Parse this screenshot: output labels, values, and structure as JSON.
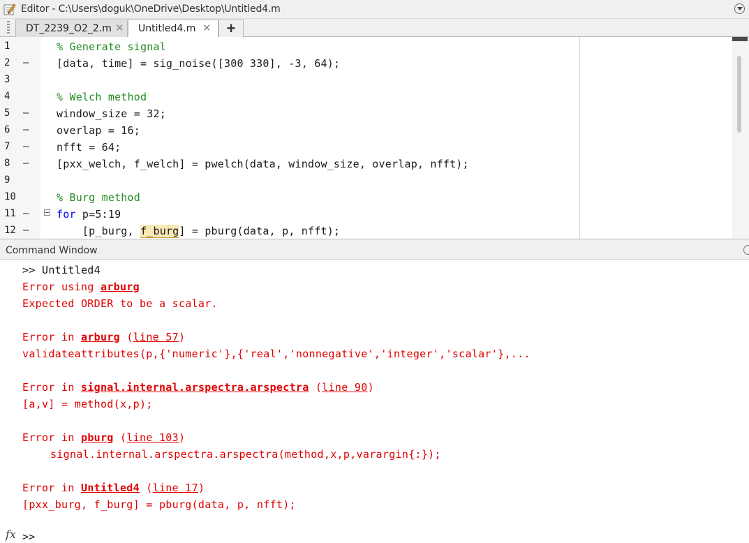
{
  "editor": {
    "title": "Editor - C:\\Users\\doguk\\OneDrive\\Desktop\\Untitled4.m",
    "tabs": [
      {
        "label": "DT_2239_O2_2.m",
        "active": false
      },
      {
        "label": "Untitled4.m",
        "active": true
      }
    ],
    "close_glyph": "✕",
    "add_tab_glyph": "+",
    "lines": [
      {
        "n": "1",
        "dash": "",
        "code": "% Generate signal",
        "type": "comment"
      },
      {
        "n": "2",
        "dash": "–",
        "code": "[data, time] = sig_noise([300 330], -3, 64);",
        "type": "code"
      },
      {
        "n": "3",
        "dash": "",
        "code": "",
        "type": "code"
      },
      {
        "n": "4",
        "dash": "",
        "code": "% Welch method",
        "type": "comment"
      },
      {
        "n": "5",
        "dash": "–",
        "code": "window_size = 32;",
        "type": "code"
      },
      {
        "n": "6",
        "dash": "–",
        "code": "overlap = 16;",
        "type": "code"
      },
      {
        "n": "7",
        "dash": "–",
        "code": "nfft = 64;",
        "type": "code"
      },
      {
        "n": "8",
        "dash": "–",
        "code": "[pxx_welch, f_welch] = pwelch(data, window_size, overlap, nfft);",
        "type": "code"
      },
      {
        "n": "9",
        "dash": "",
        "code": "",
        "type": "code"
      },
      {
        "n": "10",
        "dash": "",
        "code": "% Burg method",
        "type": "comment"
      },
      {
        "n": "11",
        "dash": "–",
        "kw": "for",
        "code": " p=5:19",
        "type": "for"
      },
      {
        "n": "12",
        "dash": "–",
        "pre": "    [p_burg, ",
        "hl": "f_burg",
        "code": "] = pburg(data, p, nfft);",
        "type": "hl"
      }
    ]
  },
  "command_window": {
    "title": "Command Window",
    "fx_label": "fx",
    "bottom_prompt": ">>",
    "output": {
      "l1": ">> Untitled4",
      "l2_pre": "Error using ",
      "l2_fn": "arburg",
      "l3": "Expected ORDER to be a scalar.",
      "l4_pre": "Error in ",
      "l4_fn": "arburg",
      "l4_mid": " (",
      "l4_link": "line 57",
      "l4_post": ")",
      "l5": "validateattributes(p,{'numeric'},{'real','nonnegative','integer','scalar'},...",
      "l6_pre": "Error in ",
      "l6_fn": "signal.internal.arspectra.arspectra",
      "l6_mid": " (",
      "l6_link": "line 90",
      "l6_post": ")",
      "l7": "[a,v] = method(x,p);",
      "l8_pre": "Error in ",
      "l8_fn": "pburg",
      "l8_mid": " (",
      "l8_link": "line 103",
      "l8_post": ")",
      "l9": "signal.internal.arspectra.arspectra(method,x,p,varargin{:});",
      "l10_pre": "Error in ",
      "l10_fn": "Untitled4",
      "l10_mid": " (",
      "l10_link": "line 17",
      "l10_post": ")",
      "l11": "[pxx_burg, f_burg] = pburg(data, p, nfft);"
    }
  }
}
